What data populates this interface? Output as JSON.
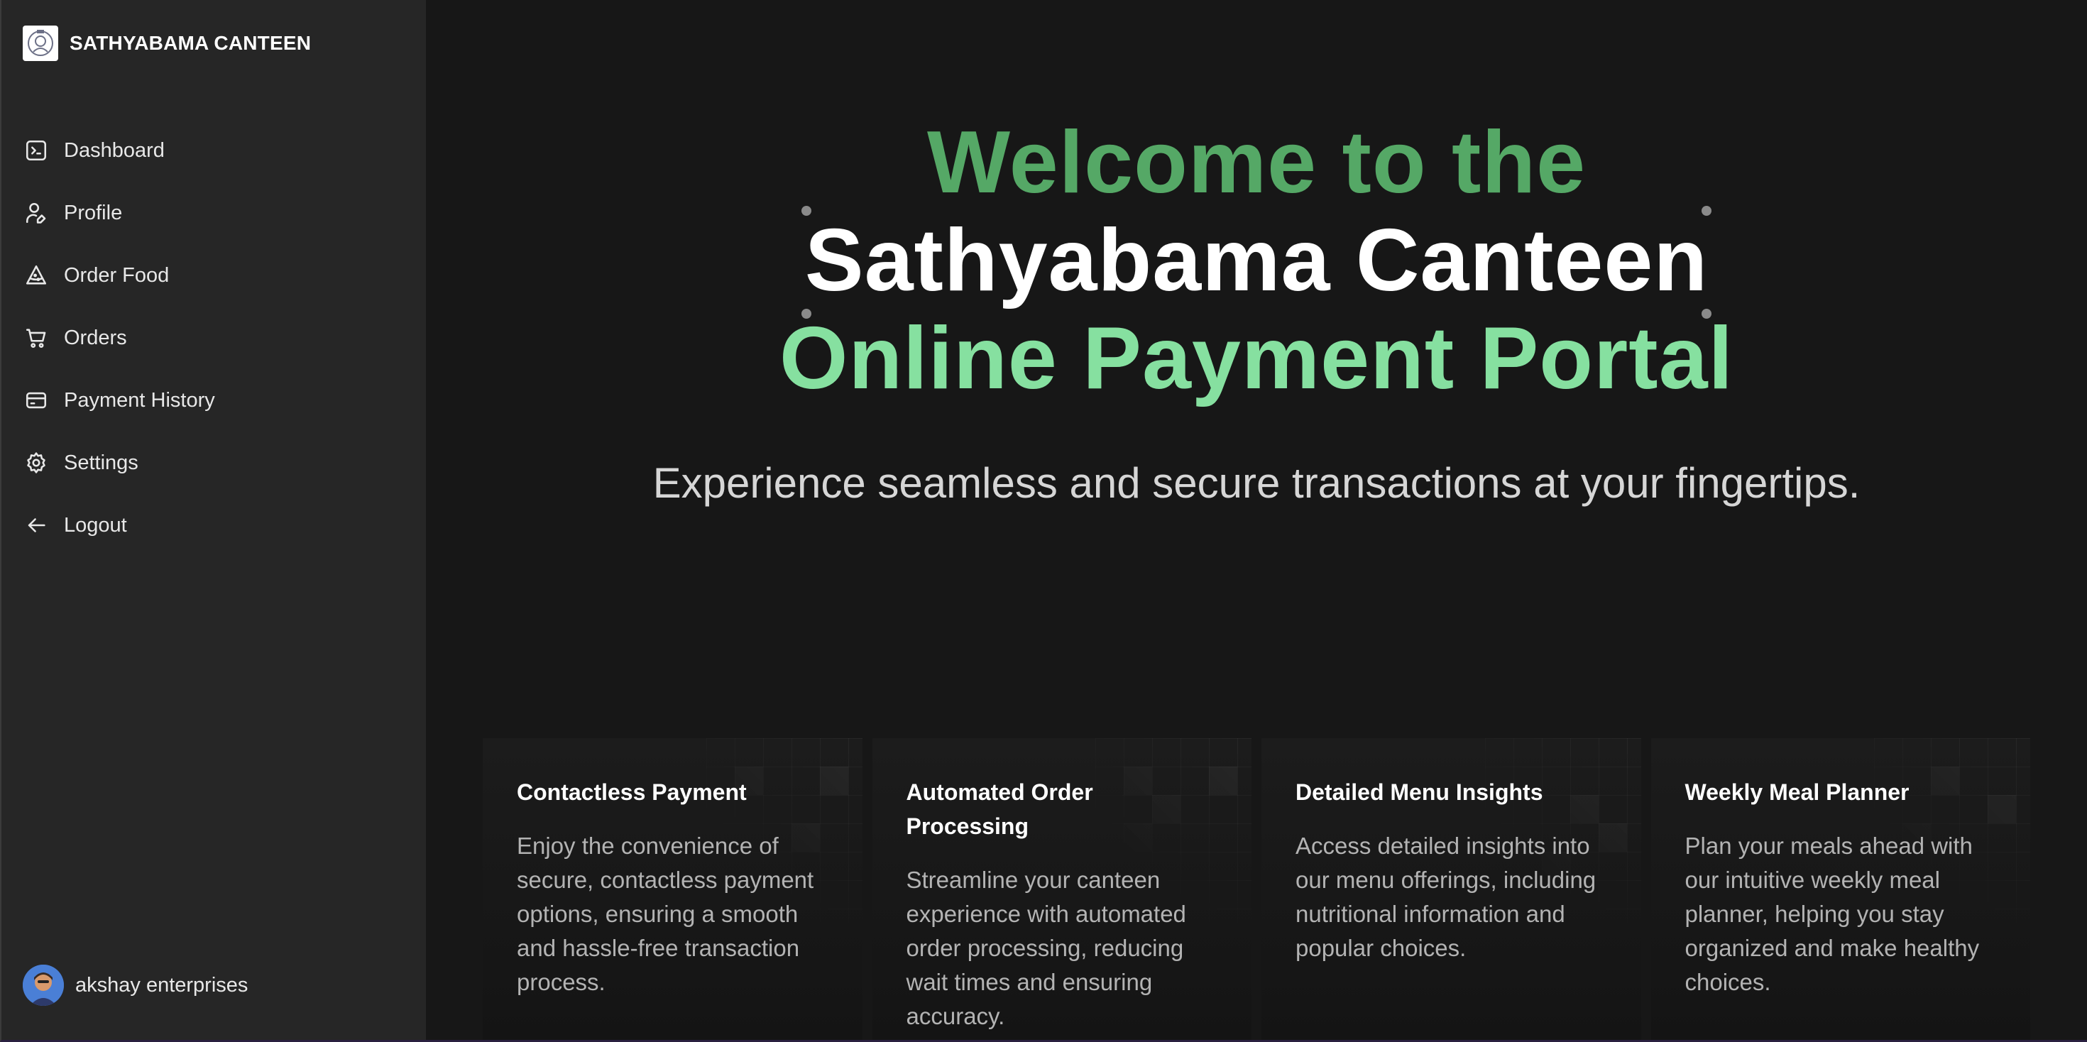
{
  "brand": {
    "name": "SATHYABAMA CANTEEN"
  },
  "sidebar": {
    "items": [
      {
        "label": "Dashboard",
        "icon": "terminal-icon"
      },
      {
        "label": "Profile",
        "icon": "user-edit-icon"
      },
      {
        "label": "Order Food",
        "icon": "pizza-slice-icon"
      },
      {
        "label": "Orders",
        "icon": "cart-icon"
      },
      {
        "label": "Payment History",
        "icon": "credit-card-icon"
      },
      {
        "label": "Settings",
        "icon": "gear-icon"
      },
      {
        "label": "Logout",
        "icon": "arrow-left-icon"
      }
    ]
  },
  "user": {
    "name": "akshay enterprises"
  },
  "hero": {
    "line1": "Welcome to the",
    "line2": "Sathyabama Canteen",
    "line3": "Online Payment Portal",
    "subtitle": "Experience seamless and secure transactions at your fingertips."
  },
  "features": [
    {
      "title": "Contactless Payment",
      "text": "Enjoy the convenience of secure, contactless payment options, ensuring a smooth and hassle-free transaction process."
    },
    {
      "title": "Automated Order Processing",
      "text": "Streamline your canteen experience with automated order processing, reducing wait times and ensuring accuracy."
    },
    {
      "title": "Detailed Menu Insights",
      "text": "Access detailed insights into our menu offerings, including nutritional information and popular choices."
    },
    {
      "title": "Weekly Meal Planner",
      "text": "Plan your meals ahead with our intuitive weekly meal planner, helping you stay organized and make healthy choices."
    }
  ],
  "colors": {
    "sidebar_bg": "#262626",
    "main_bg": "#171717",
    "hero_green_dark": "#55a866",
    "hero_green_light": "#86e0a0",
    "text_white": "#ffffff",
    "text_muted": "#b3b3b3"
  }
}
